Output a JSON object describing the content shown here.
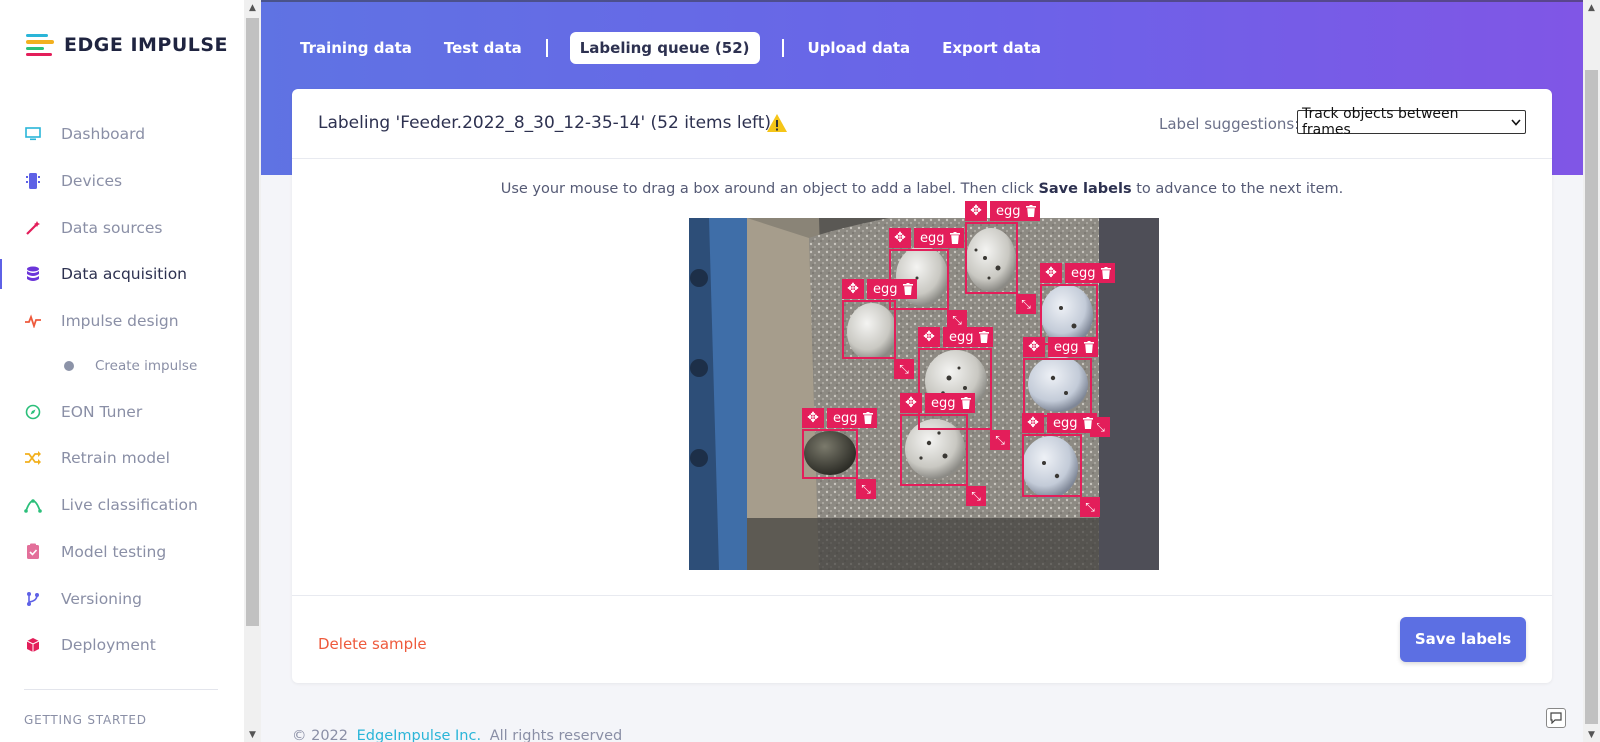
{
  "sidebar": {
    "brand": "EDGE IMPULSE",
    "items": [
      {
        "label": "Dashboard",
        "icon": "monitor-icon",
        "color": "#2ab5d8",
        "active": false
      },
      {
        "label": "Devices",
        "icon": "chip-icon",
        "color": "#5e61e6",
        "active": false
      },
      {
        "label": "Data sources",
        "icon": "magic-wand-icon",
        "color": "#e31e5a",
        "active": false
      },
      {
        "label": "Data acquisition",
        "icon": "database-icon",
        "color": "#6b35d9",
        "active": true
      },
      {
        "label": "Impulse design",
        "icon": "pulse-icon",
        "color": "#ee5a3c",
        "active": false
      }
    ],
    "sub_item": {
      "label": "Create impulse"
    },
    "items_after": [
      {
        "label": "EON Tuner",
        "icon": "compass-icon",
        "color": "#2bbf7a"
      },
      {
        "label": "Retrain model",
        "icon": "shuffle-icon",
        "color": "#f2b01e"
      },
      {
        "label": "Live classification",
        "icon": "curve-icon",
        "color": "#2bbf7a"
      },
      {
        "label": "Model testing",
        "icon": "clipboard-check-icon",
        "color": "#e36f9a"
      },
      {
        "label": "Versioning",
        "icon": "branch-icon",
        "color": "#5e61e6"
      },
      {
        "label": "Deployment",
        "icon": "cube-icon",
        "color": "#e31e5a"
      }
    ],
    "section_title": "GETTING STARTED"
  },
  "tabs": {
    "training": "Training data",
    "test": "Test data",
    "queue": "Labeling queue (52)",
    "upload": "Upload data",
    "export": "Export data"
  },
  "card": {
    "title": "Labeling 'Feeder.2022_8_30_12-35-14' (52 items left)",
    "suggestions_label": "Label suggestions:",
    "suggestions_value": "Track objects between frames",
    "instructions_pre": "Use your mouse to drag a box around an object to add a label. Then click",
    "instructions_bold": "Save labels",
    "instructions_post": "to advance to the next item.",
    "delete_label": "Delete sample",
    "save_label": "Save labels"
  },
  "labels": {
    "egg_1": "egg",
    "egg_2": "egg",
    "egg_3": "egg",
    "egg_4": "egg",
    "egg_5": "egg",
    "egg_6": "egg",
    "egg_7": "egg",
    "egg_8": "egg",
    "egg_9": "egg"
  },
  "footer": {
    "prefix": "© 2022",
    "company": "EdgeImpulse Inc.",
    "suffix": "All rights reserved"
  },
  "colors": {
    "accent": "#5c6fe3",
    "bbox": "#e31e5a",
    "danger_link": "#ee5a3c"
  }
}
